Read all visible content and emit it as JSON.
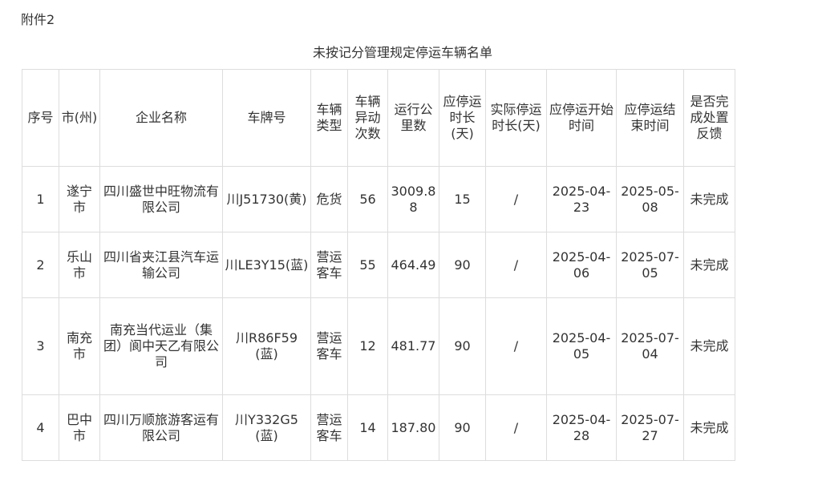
{
  "header": {
    "attachment": "附件2",
    "title": "未按记分管理规定停运车辆名单"
  },
  "table": {
    "columns": [
      "序号",
      "市(州)",
      "企业名称",
      "车牌号",
      "车辆类型",
      "车辆异动次数",
      "运行公里数",
      "应停运时长(天)",
      "实际停运时长(天)",
      "应停运开始时间",
      "应停运结束时间",
      "是否完成处置反馈"
    ],
    "rows": [
      {
        "no": "1",
        "city": "遂宁市",
        "company": "四川盛世中旺物流有限公司",
        "plate": "川J51730(黄)",
        "type": "危货",
        "count": "56",
        "km": "3009.88",
        "should_days": "15",
        "actual_days": "/",
        "start": "2025-04-23",
        "end": "2025-05-08",
        "done": "未完成"
      },
      {
        "no": "2",
        "city": "乐山市",
        "company": "四川省夹江县汽车运输公司",
        "plate": "川LE3Y15(蓝)",
        "type": "营运客车",
        "count": "55",
        "km": "464.49",
        "should_days": "90",
        "actual_days": "/",
        "start": "2025-04-06",
        "end": "2025-07-05",
        "done": "未完成"
      },
      {
        "no": "3",
        "city": "南充市",
        "company": "南充当代运业（集团）阆中天乙有限公司",
        "plate": "川R86F59(蓝)",
        "type": "营运客车",
        "count": "12",
        "km": "481.77",
        "should_days": "90",
        "actual_days": "/",
        "start": "2025-04-05",
        "end": "2025-07-04",
        "done": "未完成"
      },
      {
        "no": "4",
        "city": "巴中市",
        "company": "四川万顺旅游客运有限公司",
        "plate": "川Y332G5(蓝)",
        "type": "营运客车",
        "count": "14",
        "km": "187.80",
        "should_days": "90",
        "actual_days": "/",
        "start": "2025-04-28",
        "end": "2025-07-27",
        "done": "未完成"
      }
    ]
  }
}
